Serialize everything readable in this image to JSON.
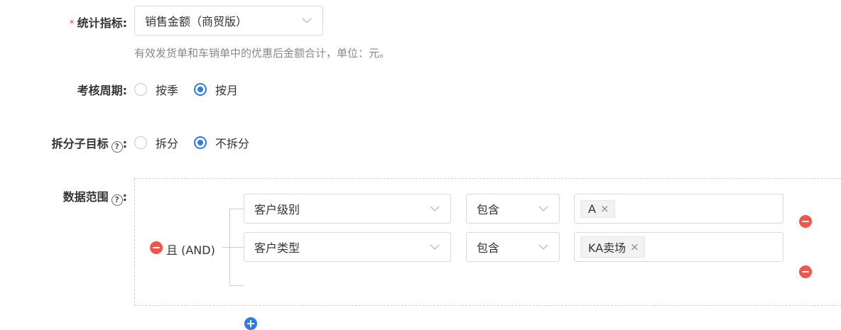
{
  "metric": {
    "required_mark": "*",
    "label": "统计指标",
    "colon": ":",
    "value": "销售金额（商贸版）",
    "hint": "有效发货单和车销单中的优惠后金额合计，单位：元。"
  },
  "period": {
    "label": "考核周期",
    "colon": ":",
    "options": [
      {
        "label": "按季",
        "selected": false
      },
      {
        "label": "按月",
        "selected": true
      }
    ]
  },
  "split": {
    "label": "拆分子目标",
    "help": "?",
    "colon": ":",
    "options": [
      {
        "label": "拆分",
        "selected": false
      },
      {
        "label": "不拆分",
        "selected": true
      }
    ]
  },
  "scope": {
    "label": "数据范围",
    "help": "?",
    "colon": ":",
    "logic_label": "且 (AND)",
    "rules": [
      {
        "field": "客户级别",
        "operator": "包含",
        "tags": [
          "A"
        ]
      },
      {
        "field": "客户类型",
        "operator": "包含",
        "tags": [
          "KA卖场"
        ]
      }
    ],
    "tag_remove": "×"
  },
  "colors": {
    "accent": "#2f7ce2",
    "danger": "#f0564b",
    "required": "#f04b4b"
  },
  "icons": [
    "chevron-down-icon",
    "help-icon",
    "remove-icon",
    "add-icon",
    "close-icon"
  ]
}
